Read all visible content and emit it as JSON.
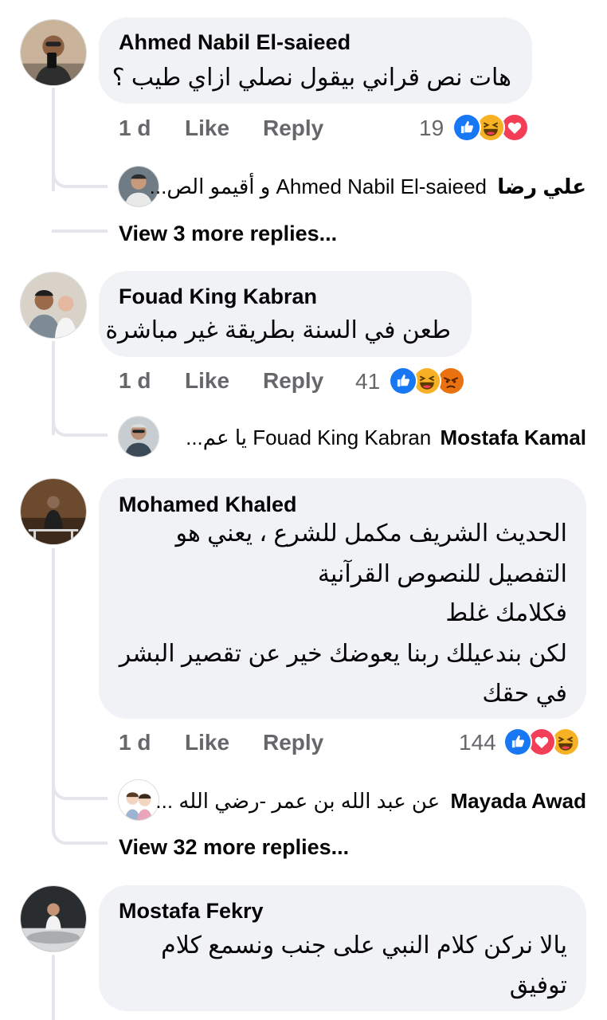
{
  "comments": [
    {
      "author": "Ahmed Nabil El-saieed",
      "lines": [
        "هات نص قراني بيقول نصلي ازاي طيب ؟"
      ],
      "age": "1 d",
      "like": "Like",
      "reply": "Reply",
      "reaction_count": "19",
      "reactions": [
        "like",
        "haha",
        "love"
      ],
      "reply_preview": {
        "name": "علي رضا",
        "snippet_name": "Ahmed Nabil El-saieed",
        "snippet": "و أقيمو الص..."
      },
      "more_replies": "View 3 more replies..."
    },
    {
      "author": "Fouad King Kabran",
      "lines": [
        "طعن في السنة بطريقة غير مباشرة"
      ],
      "age": "1 d",
      "like": "Like",
      "reply": "Reply",
      "reaction_count": "41",
      "reactions": [
        "like",
        "haha",
        "angry"
      ],
      "reply_preview": {
        "name": "Mostafa Kamal",
        "snippet_name": "Fouad King Kabran",
        "snippet": "يا عم..."
      }
    },
    {
      "author": "Mohamed Khaled",
      "lines": [
        "الحديث الشريف مكمل للشرع ، يعني هو",
        "التفصيل للنصوص القرآنية",
        "فكلامك غلط",
        "لكن بندعيلك ربنا يعوضك خير عن تقصير البشر",
        "في حقك"
      ],
      "age": "1 d",
      "like": "Like",
      "reply": "Reply",
      "reaction_count": "144",
      "reactions": [
        "like",
        "love",
        "haha"
      ],
      "reply_preview": {
        "name": "Mayada Awad",
        "snippet": "عن عبد الله بن عمر -رضي الله ..."
      },
      "more_replies": "View 32 more replies..."
    },
    {
      "author": "Mostafa Fekry",
      "lines": [
        "يالا نركن كلام النبي على جنب ونسمع كلام",
        "توفيق"
      ]
    }
  ],
  "colors": {
    "bubble": "#f0f2f5",
    "meta": "#65676b",
    "like": "#1877f2",
    "love": "#f33e58",
    "haha": "#f7b125",
    "thread": "#e4e6eb"
  }
}
